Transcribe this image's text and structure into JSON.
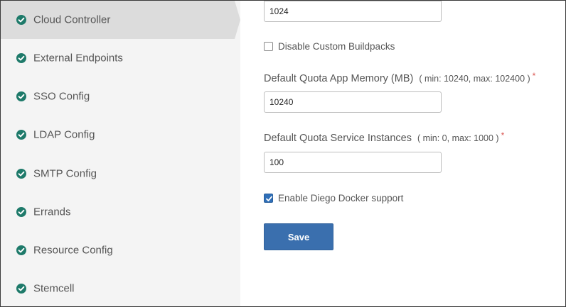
{
  "sidebar": {
    "items": [
      {
        "label": "Cloud Controller",
        "active": true
      },
      {
        "label": "External Endpoints"
      },
      {
        "label": "SSO Config"
      },
      {
        "label": "LDAP Config"
      },
      {
        "label": "SMTP Config"
      },
      {
        "label": "Errands"
      },
      {
        "label": "Resource Config"
      },
      {
        "label": "Stemcell"
      }
    ],
    "check_color": "#1e7a6a"
  },
  "form": {
    "top_field_value": "1024",
    "disable_buildpacks": {
      "label": "Disable Custom Buildpacks",
      "checked": false
    },
    "app_memory": {
      "label": "Default Quota App Memory (MB)",
      "range": "( min: 10240, max: 102400 )",
      "required": "*",
      "value": "10240"
    },
    "service_instances": {
      "label": "Default Quota Service Instances",
      "range": "( min: 0, max: 1000 )",
      "required": "*",
      "value": "100"
    },
    "diego_docker": {
      "label": "Enable Diego Docker support",
      "checked": true
    },
    "save_label": "Save"
  },
  "colors": {
    "accent": "#3a6fae",
    "required": "#d9534f"
  }
}
